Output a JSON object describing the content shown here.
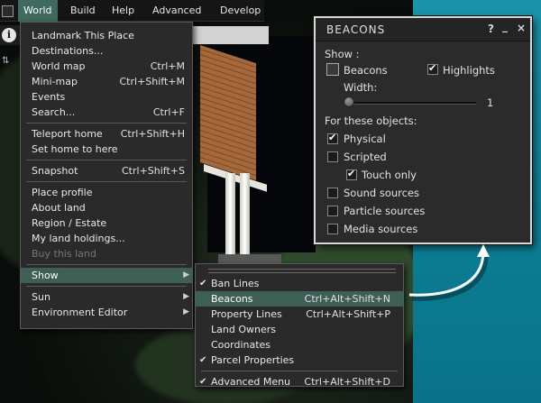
{
  "menubar": {
    "items": [
      "World",
      "Build",
      "Help",
      "Advanced",
      "Develop"
    ],
    "active": "World"
  },
  "world_menu": {
    "groups": [
      [
        {
          "label": "Landmark This Place",
          "shortcut": ""
        },
        {
          "label": "Destinations...",
          "shortcut": ""
        },
        {
          "label": "World map",
          "shortcut": "Ctrl+M"
        },
        {
          "label": "Mini-map",
          "shortcut": "Ctrl+Shift+M"
        },
        {
          "label": "Events",
          "shortcut": ""
        },
        {
          "label": "Search...",
          "shortcut": "Ctrl+F"
        }
      ],
      [
        {
          "label": "Teleport home",
          "shortcut": "Ctrl+Shift+H"
        },
        {
          "label": "Set home to here",
          "shortcut": ""
        }
      ],
      [
        {
          "label": "Snapshot",
          "shortcut": "Ctrl+Shift+S"
        }
      ],
      [
        {
          "label": "Place profile",
          "shortcut": ""
        },
        {
          "label": "About land",
          "shortcut": ""
        },
        {
          "label": "Region / Estate",
          "shortcut": ""
        },
        {
          "label": "My land holdings...",
          "shortcut": ""
        },
        {
          "label": "Buy this land",
          "shortcut": "",
          "disabled": true
        }
      ],
      [
        {
          "label": "Show",
          "shortcut": "",
          "submenu": true,
          "highlighted": true
        }
      ],
      [
        {
          "label": "Sun",
          "shortcut": "",
          "submenu": true
        },
        {
          "label": "Environment Editor",
          "shortcut": "",
          "submenu": true
        }
      ]
    ]
  },
  "show_menu": {
    "items": [
      {
        "label": "Ban Lines",
        "shortcut": "",
        "checked": true
      },
      {
        "label": "Beacons",
        "shortcut": "Ctrl+Alt+Shift+N",
        "checked": false,
        "highlighted": true
      },
      {
        "label": "Property Lines",
        "shortcut": "Ctrl+Alt+Shift+P",
        "checked": false
      },
      {
        "label": "Land Owners",
        "shortcut": "",
        "checked": false
      },
      {
        "label": "Coordinates",
        "shortcut": "",
        "checked": false
      },
      {
        "label": "Parcel Properties",
        "shortcut": "",
        "checked": true
      }
    ],
    "footer": {
      "label": "Advanced Menu",
      "shortcut": "Ctrl+Alt+Shift+D",
      "checked": true
    }
  },
  "beacons": {
    "title": "BEACONS",
    "help_icon": "?",
    "minimize_icon": "_",
    "close_icon": "×",
    "show_label": "Show :",
    "beacons_label": "Beacons",
    "beacons_checked": false,
    "highlights_label": "Highlights",
    "highlights_checked": true,
    "width_label": "Width:",
    "width_value": "1",
    "objects_label": "For these objects:",
    "physical_label": "Physical",
    "physical_checked": true,
    "scripted_label": "Scripted",
    "scripted_checked": false,
    "touch_label": "Touch only",
    "touch_checked": true,
    "sound_label": "Sound sources",
    "sound_checked": false,
    "particle_label": "Particle sources",
    "particle_checked": false,
    "media_label": "Media sources",
    "media_checked": false
  },
  "colors": {
    "menu_highlight": "#3e5f56",
    "teal_background": "#0e7f96"
  }
}
